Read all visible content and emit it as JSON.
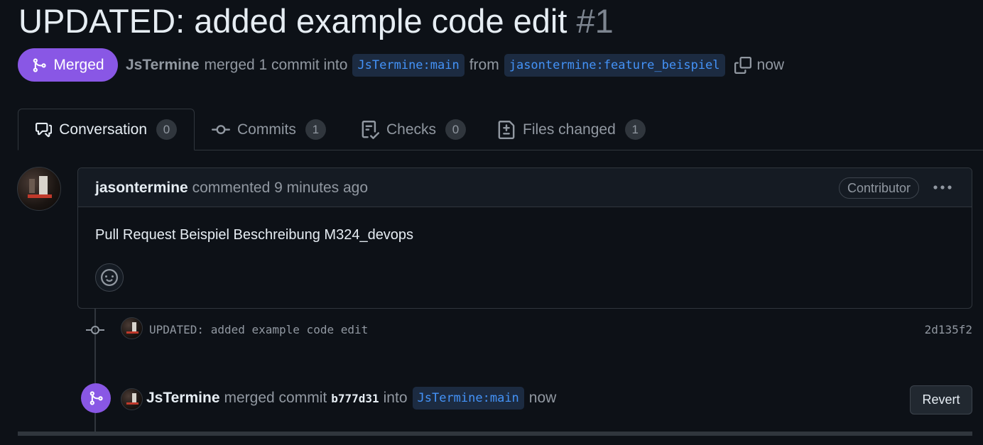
{
  "pr": {
    "title": "UPDATED: added example code edit",
    "number": "#1"
  },
  "status": {
    "label": "Merged",
    "author": "JsTermine",
    "text_merged": "merged 1 commit into",
    "base_branch": "JsTermine:main",
    "text_from": "from",
    "head_branch": "jasontermine:feature_beispiel",
    "time": "now"
  },
  "tabs": [
    {
      "label": "Conversation",
      "count": "0",
      "icon": "comment-discussion-icon"
    },
    {
      "label": "Commits",
      "count": "1",
      "icon": "git-commit-icon"
    },
    {
      "label": "Checks",
      "count": "0",
      "icon": "checklist-icon"
    },
    {
      "label": "Files changed",
      "count": "1",
      "icon": "file-diff-icon"
    }
  ],
  "comment": {
    "author": "jasontermine",
    "action": "commented 9 minutes ago",
    "role": "Contributor",
    "body": "Pull Request Beispiel Beschreibung M324_devops"
  },
  "commit": {
    "message": "UPDATED: added example code edit",
    "sha": "2d135f2"
  },
  "merge_event": {
    "author": "JsTermine",
    "text": "merged commit",
    "sha": "b777d31",
    "text_into": "into",
    "branch": "JsTermine:main",
    "time": "now",
    "revert_label": "Revert"
  },
  "colors": {
    "background": "#0d1117",
    "merged_purple": "#8957e5",
    "branch_blue": "#4493f8"
  }
}
